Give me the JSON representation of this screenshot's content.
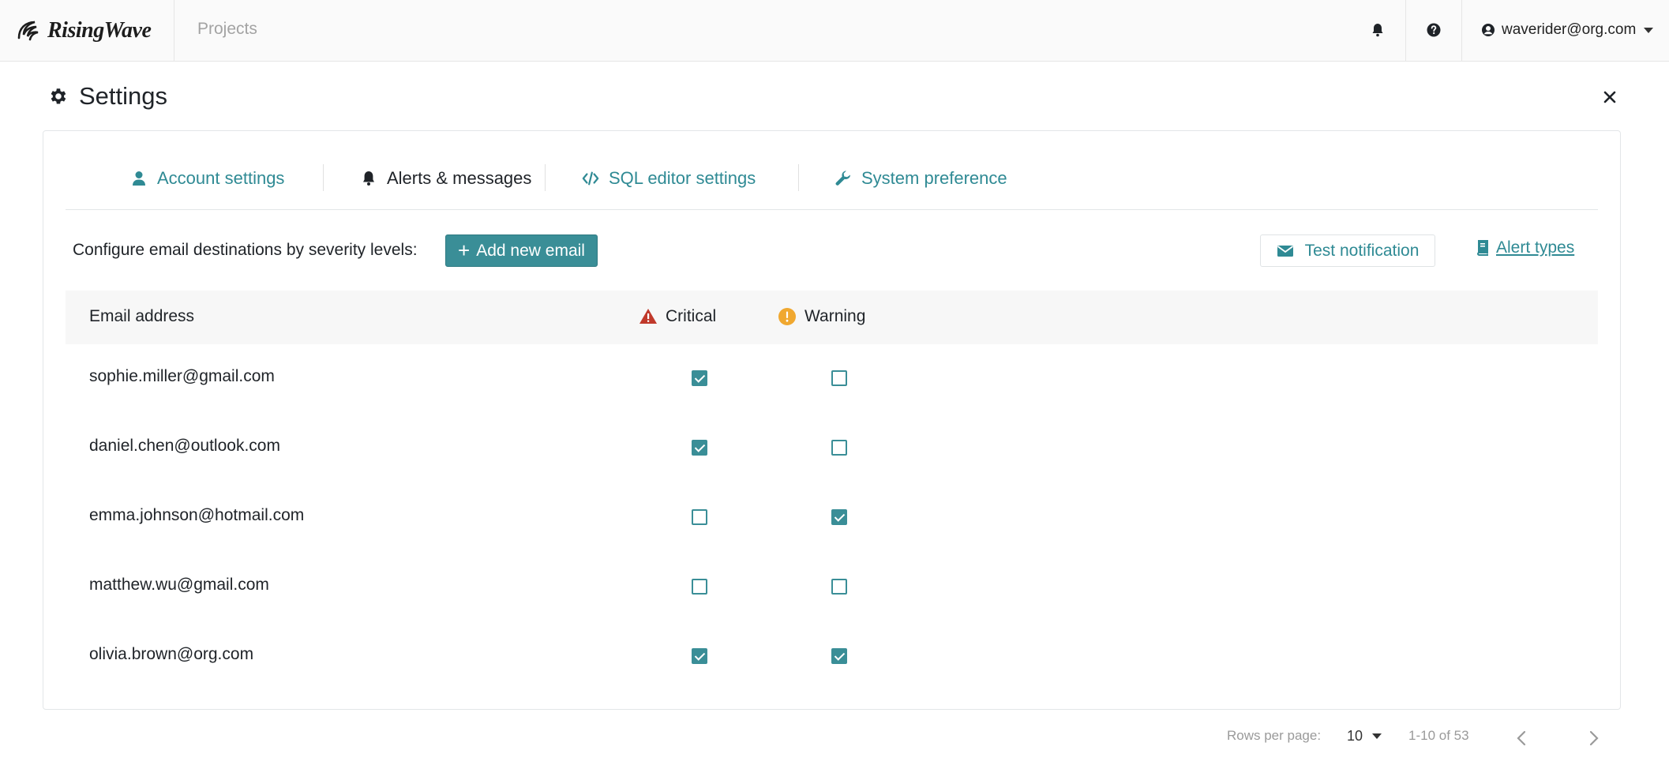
{
  "brand": {
    "name": "RisingWave"
  },
  "topbar": {
    "projects_label": "Projects",
    "user_email": "waverider@org.com"
  },
  "settings": {
    "title": "Settings",
    "tabs": [
      {
        "label": "Account settings",
        "icon": "user-icon",
        "active": false
      },
      {
        "label": "Alerts & messages",
        "icon": "bell-icon",
        "active": true
      },
      {
        "label": "SQL editor settings",
        "icon": "code-icon",
        "active": false
      },
      {
        "label": "System preference",
        "icon": "wrench-icon",
        "active": false
      }
    ],
    "config_label": "Configure email destinations by severity levels:",
    "add_button_label": "Add new email",
    "test_button_label": "Test notification",
    "alert_types_link": "Alert types"
  },
  "table": {
    "headers": {
      "email": "Email address",
      "critical": "Critical",
      "warning": "Warning"
    },
    "rows": [
      {
        "email": "sophie.miller@gmail.com",
        "critical": true,
        "warning": false
      },
      {
        "email": "daniel.chen@outlook.com",
        "critical": true,
        "warning": false
      },
      {
        "email": "emma.johnson@hotmail.com",
        "critical": false,
        "warning": true
      },
      {
        "email": "matthew.wu@gmail.com",
        "critical": false,
        "warning": false
      },
      {
        "email": "olivia.brown@org.com",
        "critical": true,
        "warning": true
      }
    ]
  },
  "pagination": {
    "rows_per_page_label": "Rows per page:",
    "rows_per_page_value": "10",
    "range": "1-10 of 53"
  },
  "colors": {
    "accent": "#3a8e97",
    "link": "#2f8a94",
    "critical": "#c0392b",
    "warning": "#f0a830"
  }
}
